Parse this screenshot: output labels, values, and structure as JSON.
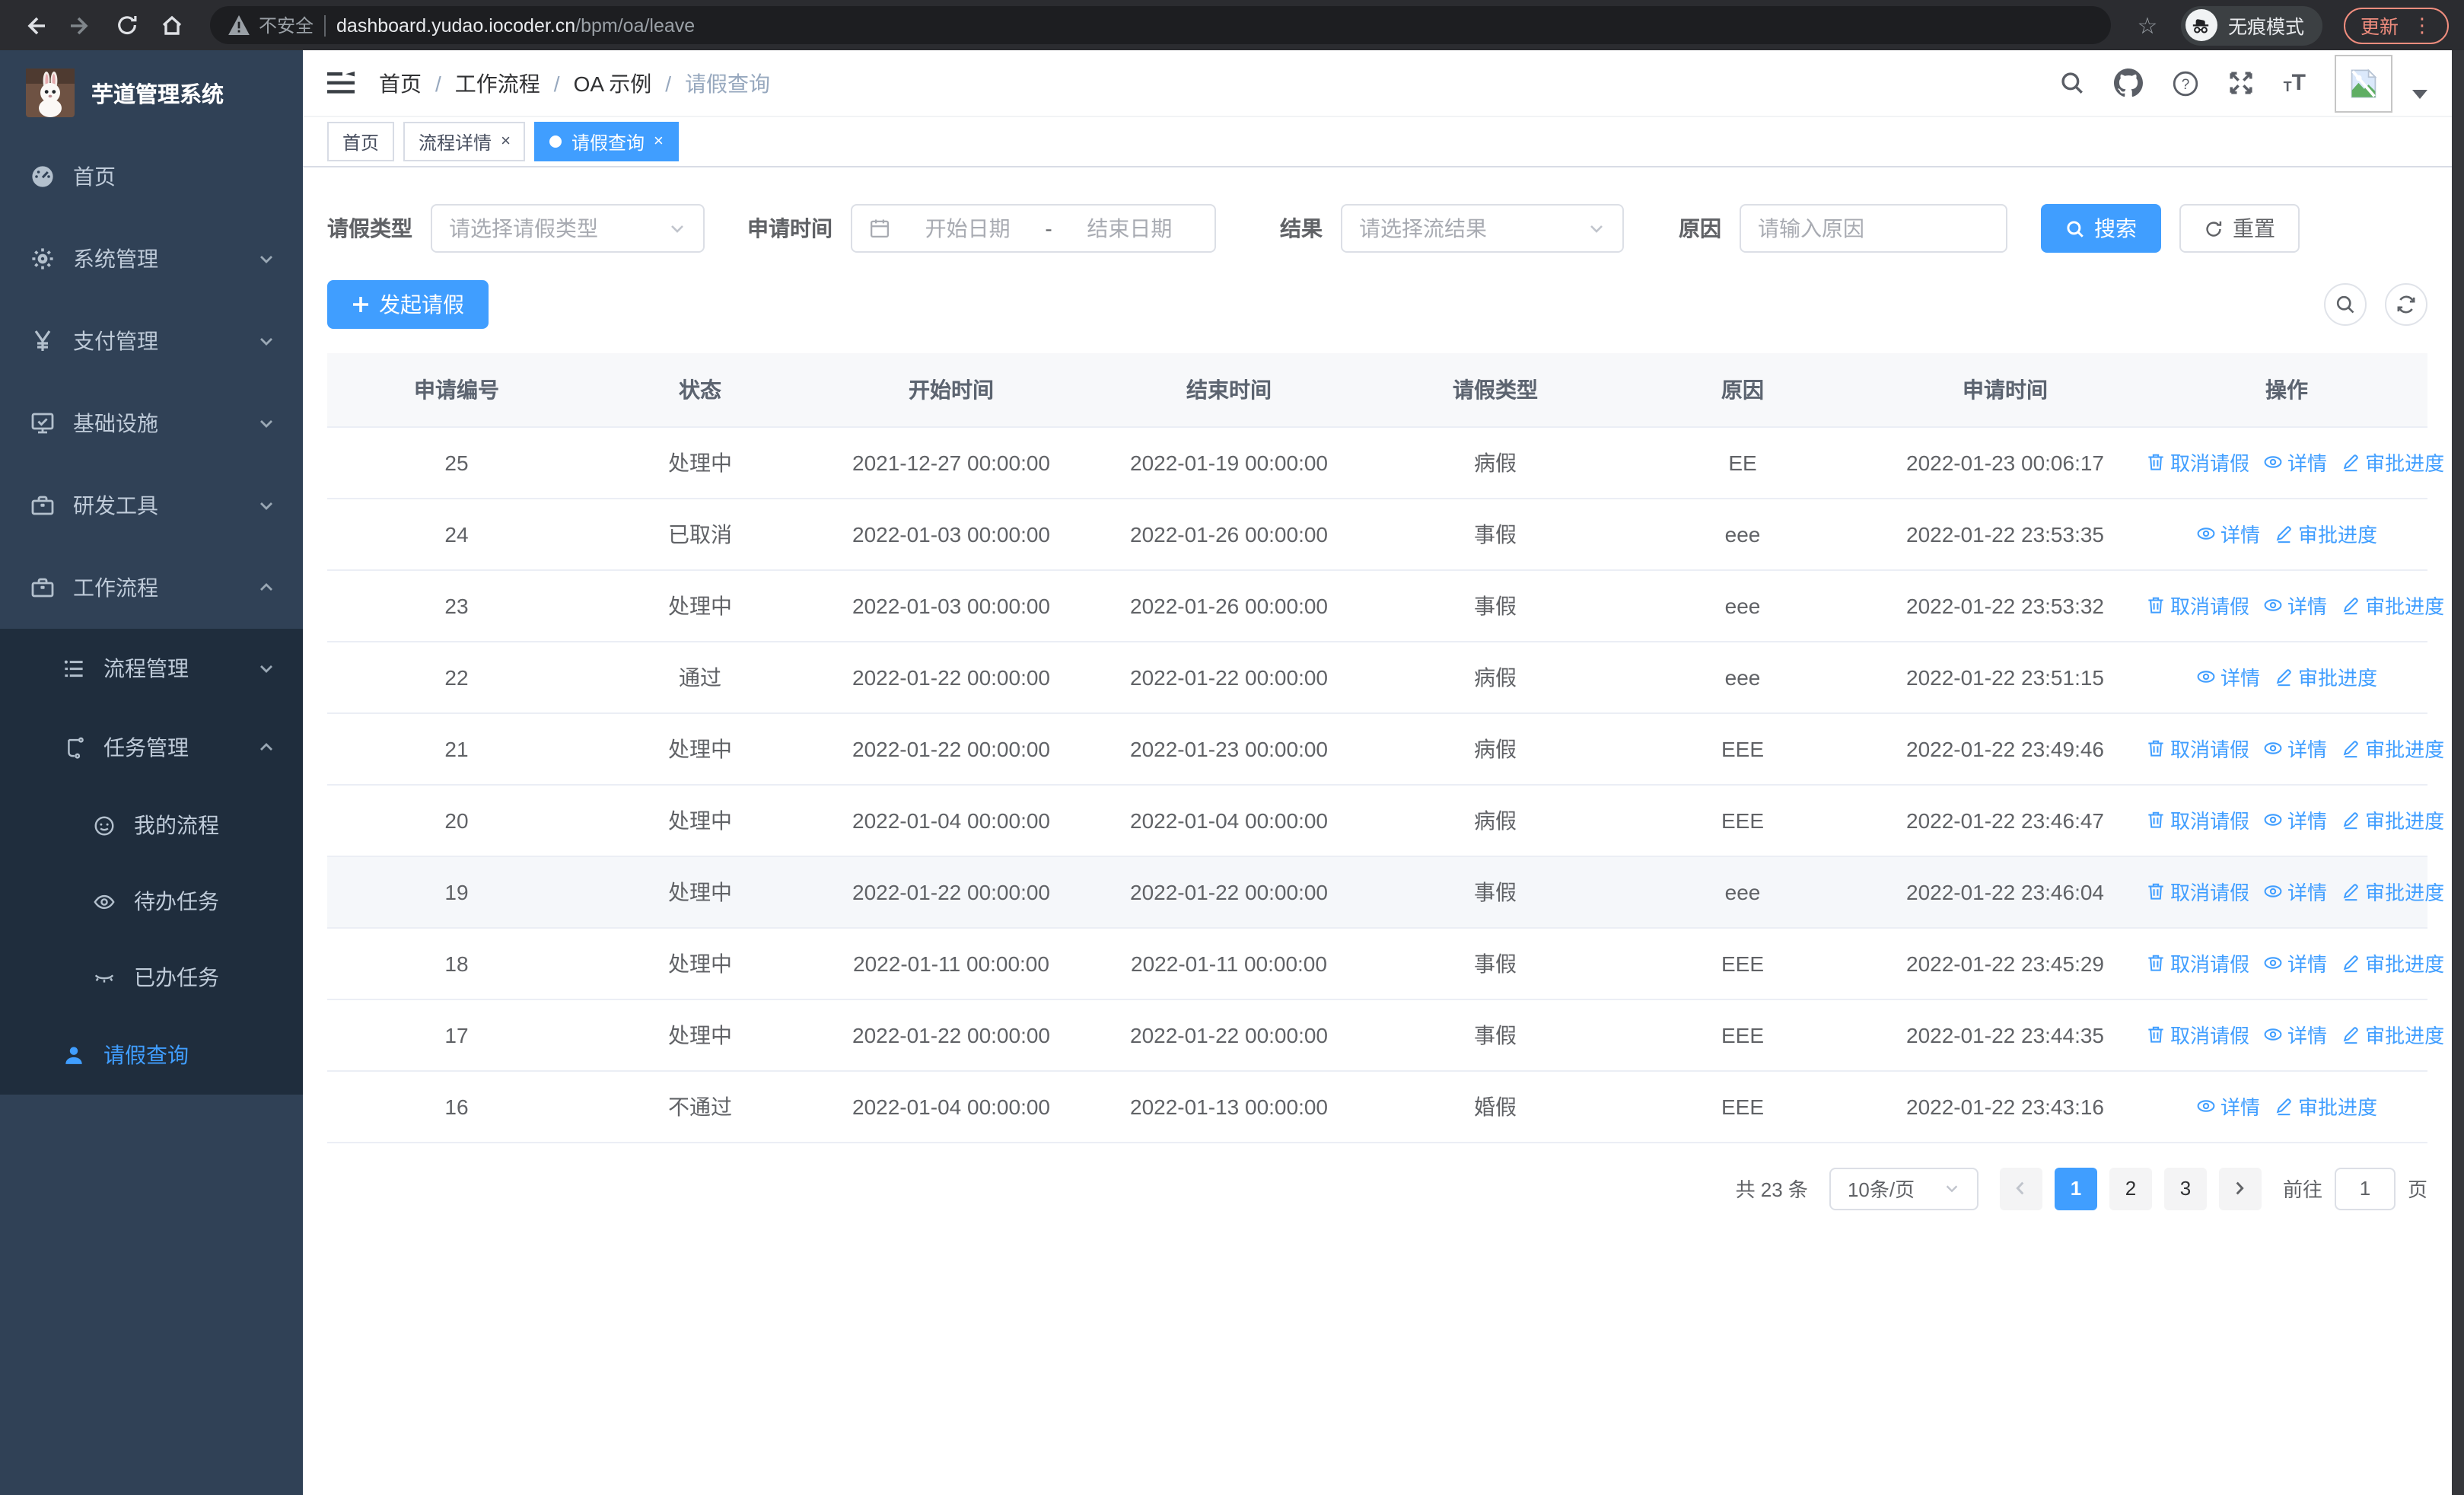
{
  "browser": {
    "security_label": "不安全",
    "url_host": "dashboard.yudao.iocoder.cn",
    "url_path": "/bpm/oa/leave",
    "incognito_label": "无痕模式",
    "update_label": "更新"
  },
  "ui": {
    "close_glyph": "×",
    "question_glyph": "?",
    "star_glyph": "☆",
    "dots_glyph": "⋮",
    "font_small": "T",
    "font_large": "T"
  },
  "sidebar": {
    "title": "芋道管理系统",
    "items": [
      {
        "label": "首页"
      },
      {
        "label": "系统管理"
      },
      {
        "label": "支付管理"
      },
      {
        "label": "基础设施"
      },
      {
        "label": "研发工具"
      },
      {
        "label": "工作流程"
      },
      {
        "label": "流程管理"
      },
      {
        "label": "任务管理"
      },
      {
        "label": "我的流程"
      },
      {
        "label": "待办任务"
      },
      {
        "label": "已办任务"
      },
      {
        "label": "请假查询"
      }
    ]
  },
  "header": {
    "breadcrumb": [
      "首页",
      "工作流程",
      "OA 示例",
      "请假查询"
    ],
    "separator": "/"
  },
  "tabs": [
    {
      "label": "首页"
    },
    {
      "label": "流程详情"
    },
    {
      "label": "请假查询"
    }
  ],
  "filters": {
    "leave_type_label": "请假类型",
    "leave_type_placeholder": "请选择请假类型",
    "apply_time_label": "申请时间",
    "start_date_placeholder": "开始日期",
    "range_separator": "-",
    "end_date_placeholder": "结束日期",
    "result_label": "结果",
    "result_placeholder": "请选择流结果",
    "reason_label": "原因",
    "reason_placeholder": "请输入原因",
    "search_label": "搜索",
    "reset_label": "重置"
  },
  "toolbar": {
    "create_label": "发起请假"
  },
  "table": {
    "columns": [
      "申请编号",
      "状态",
      "开始时间",
      "结束时间",
      "请假类型",
      "原因",
      "申请时间",
      "操作"
    ],
    "action_labels": {
      "cancel": "取消请假",
      "detail": "详情",
      "progress": "审批进度"
    },
    "rows": [
      {
        "id": "25",
        "status": "处理中",
        "start": "2021-12-27 00:00:00",
        "end": "2022-01-19 00:00:00",
        "type": "病假",
        "reason": "EE",
        "apply": "2022-01-23 00:06:17"
      },
      {
        "id": "24",
        "status": "已取消",
        "start": "2022-01-03 00:00:00",
        "end": "2022-01-26 00:00:00",
        "type": "事假",
        "reason": "eee",
        "apply": "2022-01-22 23:53:35"
      },
      {
        "id": "23",
        "status": "处理中",
        "start": "2022-01-03 00:00:00",
        "end": "2022-01-26 00:00:00",
        "type": "事假",
        "reason": "eee",
        "apply": "2022-01-22 23:53:32"
      },
      {
        "id": "22",
        "status": "通过",
        "start": "2022-01-22 00:00:00",
        "end": "2022-01-22 00:00:00",
        "type": "病假",
        "reason": "eee",
        "apply": "2022-01-22 23:51:15"
      },
      {
        "id": "21",
        "status": "处理中",
        "start": "2022-01-22 00:00:00",
        "end": "2022-01-23 00:00:00",
        "type": "病假",
        "reason": "EEE",
        "apply": "2022-01-22 23:49:46"
      },
      {
        "id": "20",
        "status": "处理中",
        "start": "2022-01-04 00:00:00",
        "end": "2022-01-04 00:00:00",
        "type": "病假",
        "reason": "EEE",
        "apply": "2022-01-22 23:46:47"
      },
      {
        "id": "19",
        "status": "处理中",
        "start": "2022-01-22 00:00:00",
        "end": "2022-01-22 00:00:00",
        "type": "事假",
        "reason": "eee",
        "apply": "2022-01-22 23:46:04"
      },
      {
        "id": "18",
        "status": "处理中",
        "start": "2022-01-11 00:00:00",
        "end": "2022-01-11 00:00:00",
        "type": "事假",
        "reason": "EEE",
        "apply": "2022-01-22 23:45:29"
      },
      {
        "id": "17",
        "status": "处理中",
        "start": "2022-01-22 00:00:00",
        "end": "2022-01-22 00:00:00",
        "type": "事假",
        "reason": "EEE",
        "apply": "2022-01-22 23:44:35"
      },
      {
        "id": "16",
        "status": "不通过",
        "start": "2022-01-04 00:00:00",
        "end": "2022-01-13 00:00:00",
        "type": "婚假",
        "reason": "EEE",
        "apply": "2022-01-22 23:43:16"
      }
    ]
  },
  "pagination": {
    "total_label": "共 23 条",
    "page_size": "10条/页",
    "pages": [
      "1",
      "2",
      "3"
    ],
    "goto_label": "前往",
    "goto_value": "1",
    "page_suffix": "页"
  },
  "colors": {
    "primary": "#409EFF",
    "sidebar_bg": "#304156",
    "submenu_bg": "#1f2d3d"
  }
}
